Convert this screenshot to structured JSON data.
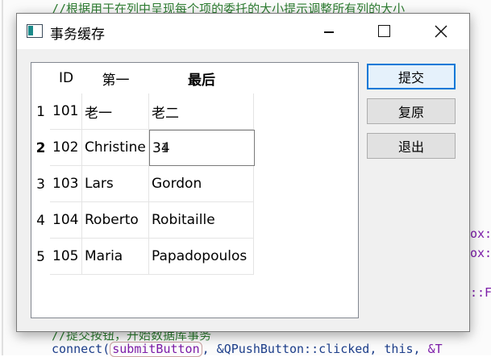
{
  "background_code": {
    "top_comment": "//根据用于在列中呈现每个项的委托的大小提示调整所有列的大小",
    "right_fragments": [
      "ox:",
      "ox:",
      "::F",
      "&T"
    ],
    "bottom_comment": "//提交按钮，开始数据库事务",
    "connect_line": {
      "prefix": "connect(",
      "boxed": "submitButton",
      "suffix": ", &QPushButton::clicked, this, "
    }
  },
  "window": {
    "title": "事务缓存",
    "icon": "window-app-icon",
    "controls": [
      "minimize-icon",
      "maximize-icon",
      "close-icon"
    ]
  },
  "table": {
    "corner_label": "",
    "columns": [
      "ID",
      "第一",
      "最后"
    ],
    "bold_column_index": 2,
    "rows": [
      {
        "header": "1",
        "id": "101",
        "first": "老一",
        "last": "老二",
        "bold": false
      },
      {
        "header": "2",
        "id": "102",
        "first": "Christine",
        "last": "3",
        "bold": true,
        "editing": true,
        "after_cursor": "4"
      },
      {
        "header": "3",
        "id": "103",
        "first": "Lars",
        "last": "Gordon",
        "bold": false
      },
      {
        "header": "4",
        "id": "104",
        "first": "Roberto",
        "last": "Robitaille",
        "bold": false
      },
      {
        "header": "5",
        "id": "105",
        "first": "Maria",
        "last": "Papadopoulos",
        "bold": false
      }
    ]
  },
  "buttons": {
    "submit": "提交",
    "revert": "复原",
    "quit": "退出"
  },
  "colors": {
    "accent": "#0078d7",
    "comment": "#2e7d32",
    "code_keyword": "#7c1ca8"
  }
}
